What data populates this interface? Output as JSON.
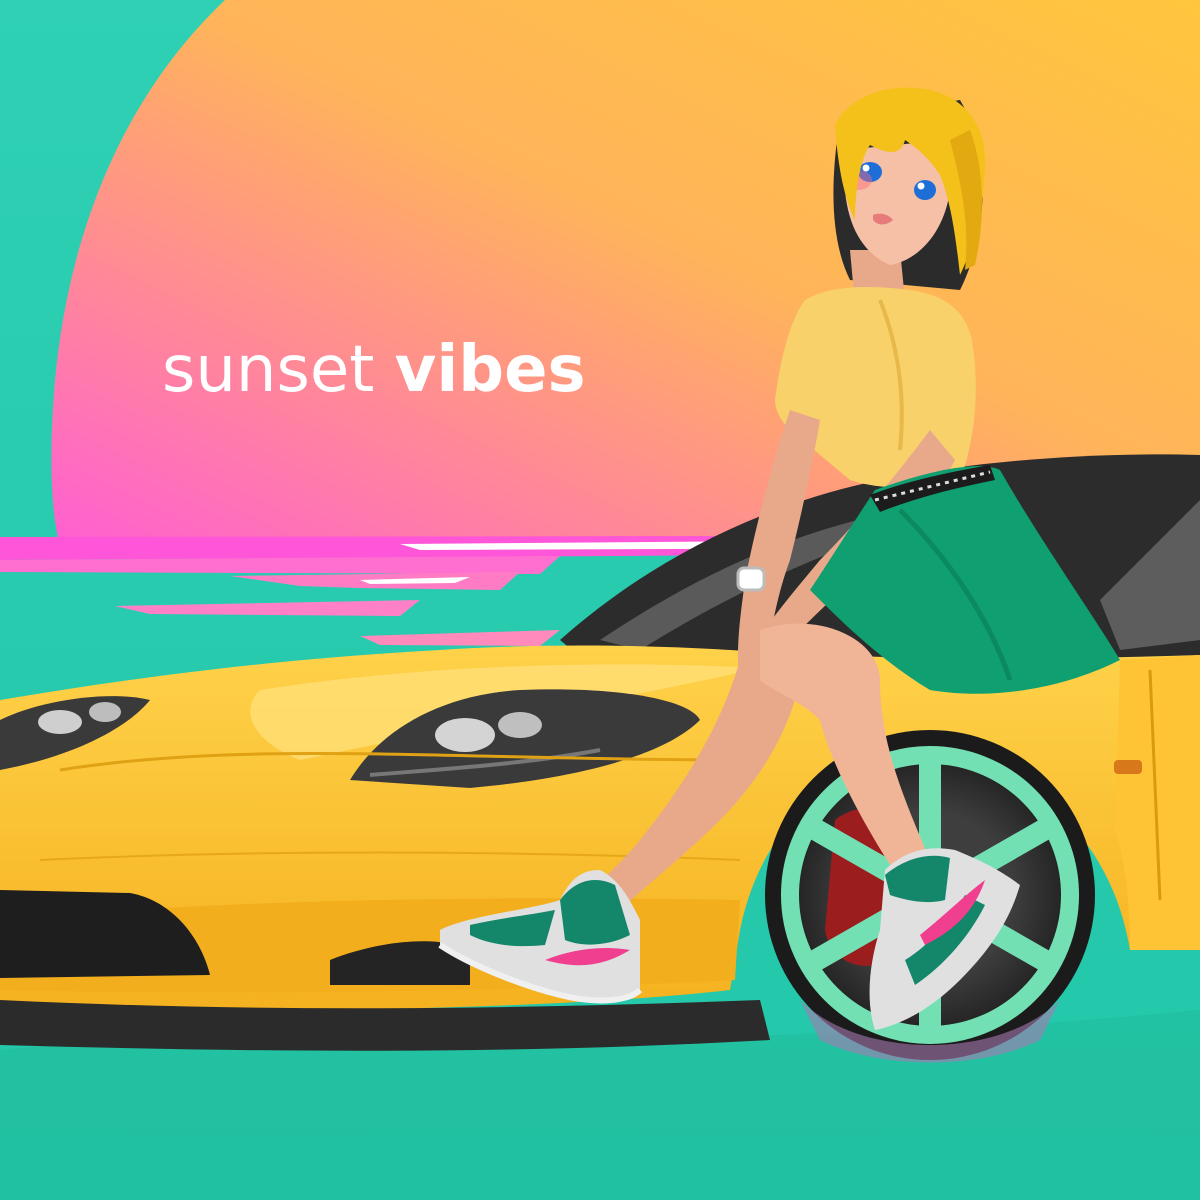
{
  "headline": {
    "word_light": "sunset",
    "word_bold": "vibes"
  },
  "palette": {
    "teal_background": "#2fc9ad",
    "teal_dark": "#13b89d",
    "sun_pink": "#ff5fd2",
    "sun_orange": "#ffb45a",
    "sun_yellow": "#ffc63d",
    "car_yellow": "#fdc02f",
    "car_shadow": "#e8a418",
    "wheel_mint": "#73e0b4",
    "brake_red": "#9b1d1d",
    "skirt_green": "#109f70",
    "shirt_yellow": "#f8d16a",
    "hair_blonde": "#f4c01a",
    "shoe_pink": "#f13f8f",
    "text_white": "#ffffff"
  },
  "illustration": {
    "subject": "anime-girl",
    "vehicle": "yellow-sports-car"
  }
}
